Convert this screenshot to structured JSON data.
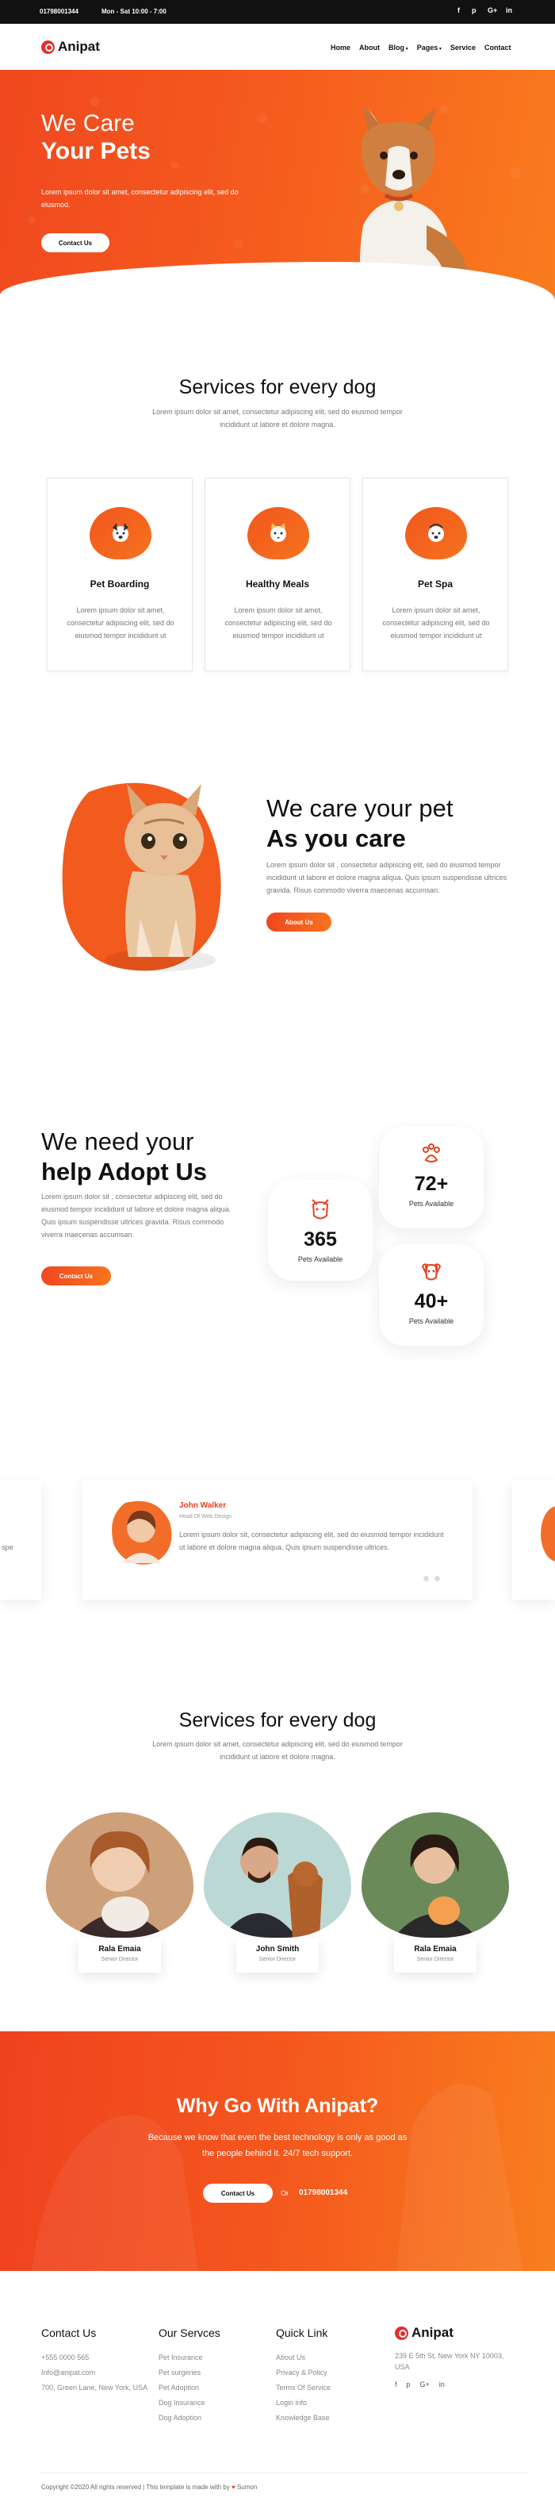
{
  "topbar": {
    "phone": "01798001344",
    "hours": "Mon - Sat 10:00 - 7:00",
    "social": [
      "f",
      "p",
      "G+",
      "in"
    ]
  },
  "nav": {
    "logo": "Anipat",
    "menu": [
      "Home",
      "About",
      "Blog",
      "Pages",
      "Service",
      "Contact"
    ]
  },
  "hero": {
    "line1": "We Care",
    "line2": "Your Pets",
    "text": "Lorem ipsum dolor sit amet, consectetur adipiscing elit, sed do eiusmod.",
    "button": "Contact Us"
  },
  "services": {
    "title": "Services for every dog",
    "subtitle": "Lorem ipsum dolor sit amet, consectetur adipiscing elit, sed do eiusmod tempor incididunt ut labore et dolore magna.",
    "cards": [
      {
        "title": "Pet Boarding",
        "text": "Lorem ipsum dolor sit amet, consectetur adipiscing elit, sed do eiusmod tempor incididunt ut",
        "icon": "dog-icon"
      },
      {
        "title": "Healthy Meals",
        "text": "Lorem ipsum dolor sit amet, consectetur adipiscing elit, sed do eiusmod tempor incididunt ut",
        "icon": "cat-icon"
      },
      {
        "title": "Pet Spa",
        "text": "Lorem ipsum dolor sit amet, consectetur adipiscing elit, sed do eiusmod tempor incididunt ut",
        "icon": "spa-icon"
      }
    ]
  },
  "care": {
    "line1": "We care your pet",
    "line2": "As you care",
    "text": "Lorem ipsum dolor sit , consectetur adipiscing elit, sed do eiusmod tempor incididunt ut labore et dolore magna aliqua. Quis ipsum suspendisse ultrices gravida. Risus commodo viverra maecenas accumsan.",
    "button": "About Us"
  },
  "adopt": {
    "line1": "We need your",
    "line2": "help Adopt Us",
    "text": "Lorem ipsum dolor sit , consectetur adipiscing elit, sed do eiusmod tempor incididunt ut labore et dolore magna aliqua. Quis ipsum suspendisse ultrices gravida. Risus commodo viverra maecenas accumsan.",
    "button": "Contact Us",
    "stats": [
      {
        "num": "365",
        "label": "Pets Available"
      },
      {
        "num": "72+",
        "label": "Pets Available"
      },
      {
        "num": "40+",
        "label": "Pets Available"
      }
    ]
  },
  "testimonial": {
    "name": "John Walker",
    "role": "Head Of Web Design",
    "text": "Lorem ipsum dolor sit, consectetur adipiscing elit, sed do eiusmod tempor incididunt ut labore et dolore magna aliqua. Quis ipsum suspendisse ultrices.",
    "side_text": "spe"
  },
  "team": {
    "title": "Services for every dog",
    "subtitle": "Lorem ipsum dolor sit amet, consectetur adipiscing elit, sed do eiusmod tempor incididunt ut labore et dolore magna.",
    "members": [
      {
        "name": "Rala Emaia",
        "role": "Senior Director"
      },
      {
        "name": "John Smith",
        "role": "Senior Director"
      },
      {
        "name": "Rala Emaia",
        "role": "Senior Director"
      }
    ]
  },
  "why": {
    "title": "Why Go With Anipat?",
    "text": "Because we know that even the best technology is only as good as the people behind it. 24/7 tech support.",
    "button": "Contact Us",
    "or": "Or",
    "phone": "01798001344"
  },
  "footer": {
    "contact": {
      "title": "Contact Us",
      "lines": [
        "+555 0000 565",
        "Info@anipat.com",
        "700, Green Lane, New York, USA"
      ]
    },
    "services": {
      "title": "Our Servces",
      "links": [
        "Pet Insurance",
        "Pet surgeries",
        "Pet Adoption",
        "Dog Insurance",
        "Dog Adoption"
      ]
    },
    "quick": {
      "title": "Quick Link",
      "links": [
        "About Us",
        "Privacy & Policy",
        "Terms Of Service",
        "Login info",
        "Knowledge Base"
      ]
    },
    "brand": {
      "logo": "Anipat",
      "address": "239 E 5th St, New York NY 10003, USA",
      "social": [
        "f",
        "p",
        "G+",
        "in"
      ]
    },
    "copyright": "Copyright ©2020 All rights reserved | This template is made with by",
    "author": "Sumon"
  },
  "colors": {
    "accent": "#f4511e",
    "accent2": "#f97c1e",
    "dark": "#111111"
  }
}
